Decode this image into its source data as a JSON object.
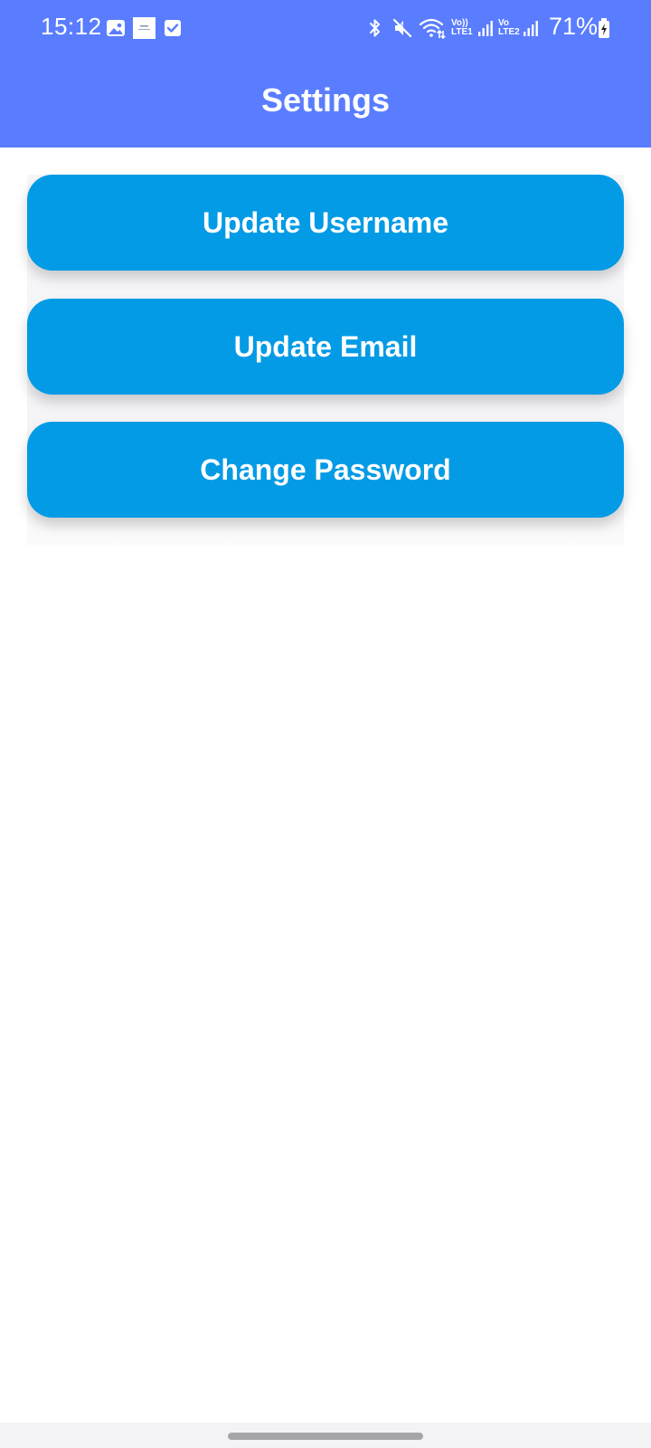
{
  "status_bar": {
    "time": "15:12",
    "battery_percent": "71%",
    "sim1_label_top": "Vo))",
    "sim1_label_bottom": "LTE1",
    "sim2_label_top": "Vo",
    "sim2_label_bottom": "LTE2",
    "icons": [
      "image-icon",
      "notification-thumbnail-icon",
      "checkbox-icon",
      "bluetooth-icon",
      "mute-icon",
      "wifi-icon",
      "signal-icon",
      "battery-charging-icon"
    ]
  },
  "header": {
    "title": "Settings"
  },
  "settings_actions": [
    {
      "label": "Update Username"
    },
    {
      "label": "Update Email"
    },
    {
      "label": "Change Password"
    }
  ],
  "colors": {
    "header": "#5a7dff",
    "button": "#039be5",
    "background": "#ffffff"
  }
}
